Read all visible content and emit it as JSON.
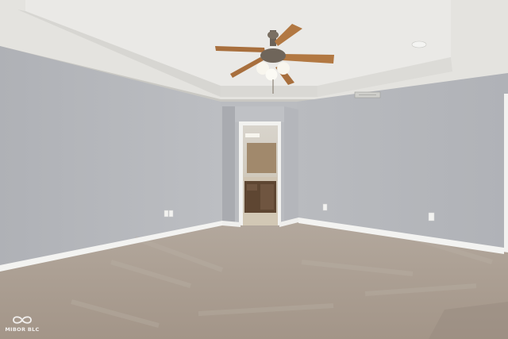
{
  "photo": {
    "subject": "empty-bedroom",
    "colors": {
      "ceiling": "#e6e5e1",
      "wall_left": "#b4b6ba",
      "wall_back": "#b9bbbf",
      "wall_right": "#b7b9bd",
      "carpet": "#ada196",
      "baseboard": "#f3f3f1",
      "fan_blade": "#b27842",
      "vanity": "#5e4632"
    }
  },
  "watermark": {
    "text": "MIBOR BLC",
    "icon": "infinity-icon"
  }
}
